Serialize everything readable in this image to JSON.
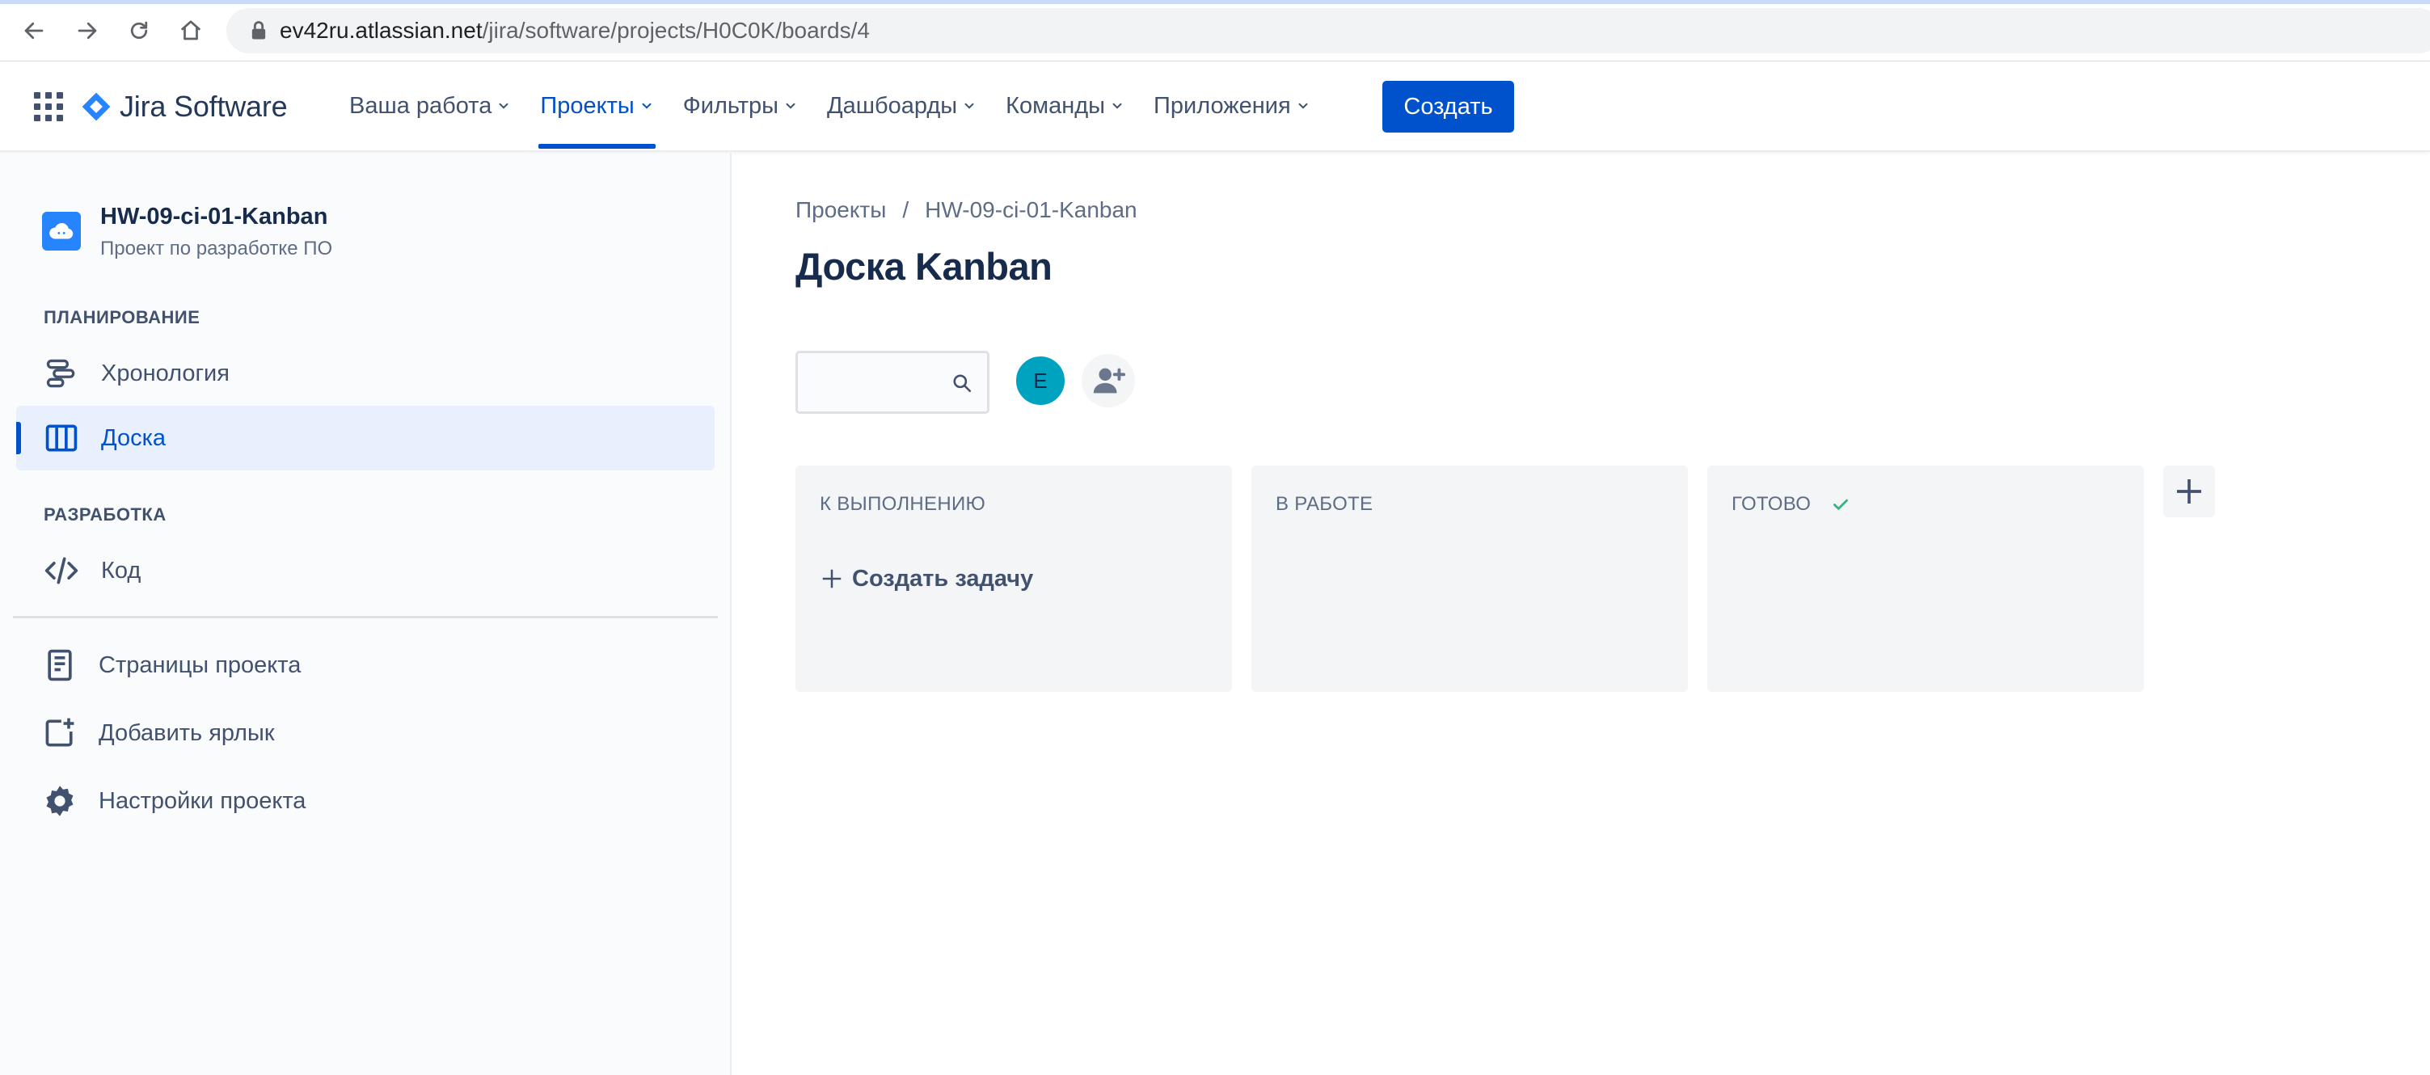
{
  "browser": {
    "url_host": "ev42ru.atlassian.net",
    "url_path": "/jira/software/projects/H0C0K/boards/4"
  },
  "topnav": {
    "logo_text": "Jira Software",
    "items": [
      {
        "label": "Ваша работа",
        "active": false
      },
      {
        "label": "Проекты",
        "active": true
      },
      {
        "label": "Фильтры",
        "active": false
      },
      {
        "label": "Дашбоарды",
        "active": false
      },
      {
        "label": "Команды",
        "active": false
      },
      {
        "label": "Приложения",
        "active": false
      }
    ],
    "create_label": "Создать"
  },
  "sidebar": {
    "project_name": "HW-09-ci-01-Kanban",
    "project_type": "Проект по разработке ПО",
    "planning_title": "ПЛАНИРОВАНИЕ",
    "timeline_label": "Хронология",
    "board_label": "Доска",
    "dev_title": "РАЗРАБОТКА",
    "code_label": "Код",
    "pages_label": "Страницы проекта",
    "shortcut_label": "Добавить ярлык",
    "settings_label": "Настройки проекта"
  },
  "main": {
    "breadcrumb": [
      "Проекты",
      "HW-09-ci-01-Kanban"
    ],
    "breadcrumb_sep": "/",
    "title": "Доска Kanban",
    "search_value": "",
    "user_initial": "E",
    "columns": [
      {
        "title": "К ВЫПОЛНЕНИЮ",
        "done": false
      },
      {
        "title": "В РАБОТЕ",
        "done": false
      },
      {
        "title": "ГОТОВО",
        "done": true
      }
    ],
    "create_issue_label": "Создать задачу"
  },
  "colors": {
    "accent": "#0052cc",
    "selected_bg": "#e8f0fd",
    "column_bg": "#f4f5f7",
    "avatar": "#00a3bf",
    "done_check": "#36b37e"
  }
}
